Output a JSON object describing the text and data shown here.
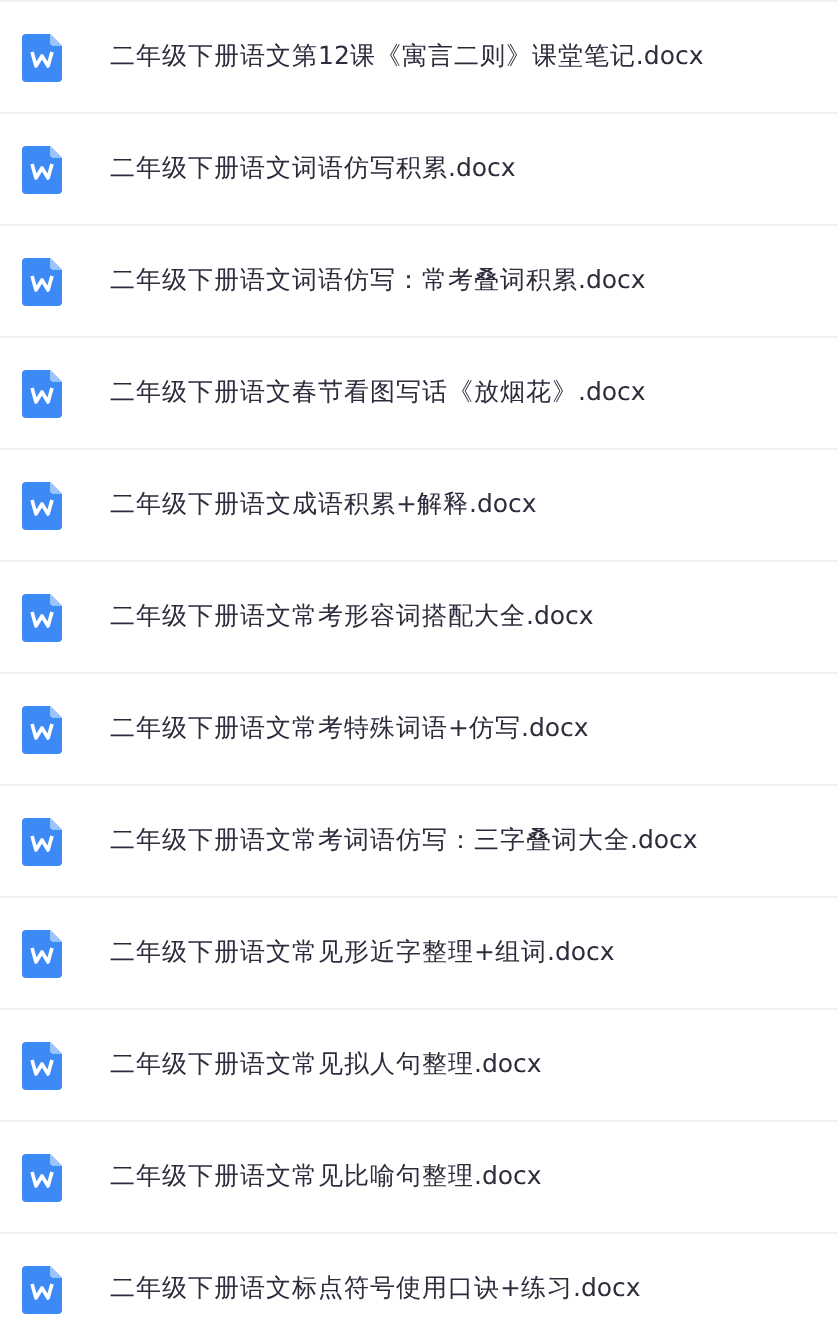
{
  "files": [
    {
      "name": "二年级下册语文第12课《寓言二则》课堂笔记.docx",
      "kind": "word"
    },
    {
      "name": "二年级下册语文词语仿写积累.docx",
      "kind": "word"
    },
    {
      "name": "二年级下册语文词语仿写：常考叠词积累.docx",
      "kind": "word"
    },
    {
      "name": "二年级下册语文春节看图写话《放烟花》.docx",
      "kind": "word"
    },
    {
      "name": "二年级下册语文成语积累+解释.docx",
      "kind": "word"
    },
    {
      "name": "二年级下册语文常考形容词搭配大全.docx",
      "kind": "word"
    },
    {
      "name": "二年级下册语文常考特殊词语+仿写.docx",
      "kind": "word"
    },
    {
      "name": "二年级下册语文常考词语仿写：三字叠词大全.docx",
      "kind": "word"
    },
    {
      "name": "二年级下册语文常见形近字整理+组词.docx",
      "kind": "word"
    },
    {
      "name": "二年级下册语文常见拟人句整理.docx",
      "kind": "word"
    },
    {
      "name": "二年级下册语文常见比喻句整理.docx",
      "kind": "word"
    },
    {
      "name": "二年级下册语文标点符号使用口诀+练习.docx",
      "kind": "word"
    }
  ]
}
